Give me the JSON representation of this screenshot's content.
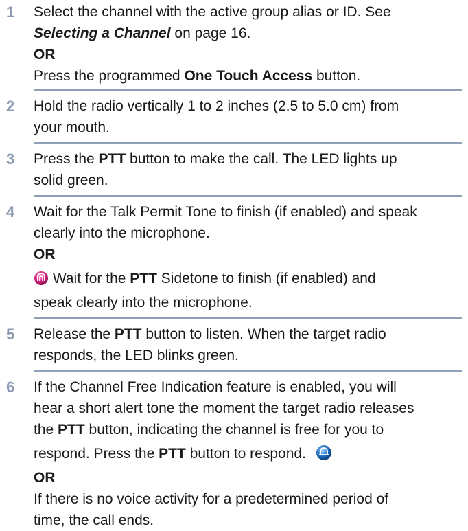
{
  "steps": [
    {
      "num": "1",
      "l1": "Select the channel with the active group alias or ID. See",
      "l2_link": "Selecting a Channel",
      "l2_tail": " on page 16.",
      "or": "OR",
      "l4_pre": "Press the programmed ",
      "l4_bold": "One Touch Access",
      "l4_tail": " button."
    },
    {
      "num": "2",
      "l1": "Hold the radio vertically 1 to 2 inches (2.5 to 5.0 cm) from",
      "l2": "your mouth."
    },
    {
      "num": "3",
      "l1_pre": "Press the ",
      "l1_bold": "PTT",
      "l1_tail": " button to make the call. The LED lights up",
      "l2": "solid green."
    },
    {
      "num": "4",
      "l1": "Wait for the Talk Permit Tone to finish (if enabled) and speak",
      "l2": "clearly into the microphone.",
      "or": "OR",
      "l4_pre": " Wait for the ",
      "l4_bold": "PTT",
      "l4_tail": " Sidetone to finish (if enabled) and",
      "l5": "speak clearly into the microphone."
    },
    {
      "num": "5",
      "l1_pre": "Release the ",
      "l1_bold": "PTT",
      "l1_tail": " button to listen. When the target radio",
      "l2": "responds, the LED blinks green."
    },
    {
      "num": "6",
      "l1": "If the Channel Free Indication feature is enabled, you will",
      "l2": "hear a short alert tone the moment the target radio releases",
      "l3_pre": "the ",
      "l3_bold": "PTT",
      "l3_tail": " button, indicating the channel is free for you to",
      "l4_pre": "respond. Press the ",
      "l4_bold": "PTT",
      "l4_tail": " button to respond.",
      "or": "OR",
      "l6": "If there is no voice activity for a predetermined period of",
      "l7": "time, the call ends."
    }
  ],
  "icons": {
    "step4": "pink-radio-indicator-icon",
    "step6": "blue-radio-indicator-icon"
  },
  "colors": {
    "number": "#8a9bb3",
    "separator": "#8ea0b8",
    "pink_icon": "#d4237e",
    "blue_icon": "#1f6fc1"
  }
}
